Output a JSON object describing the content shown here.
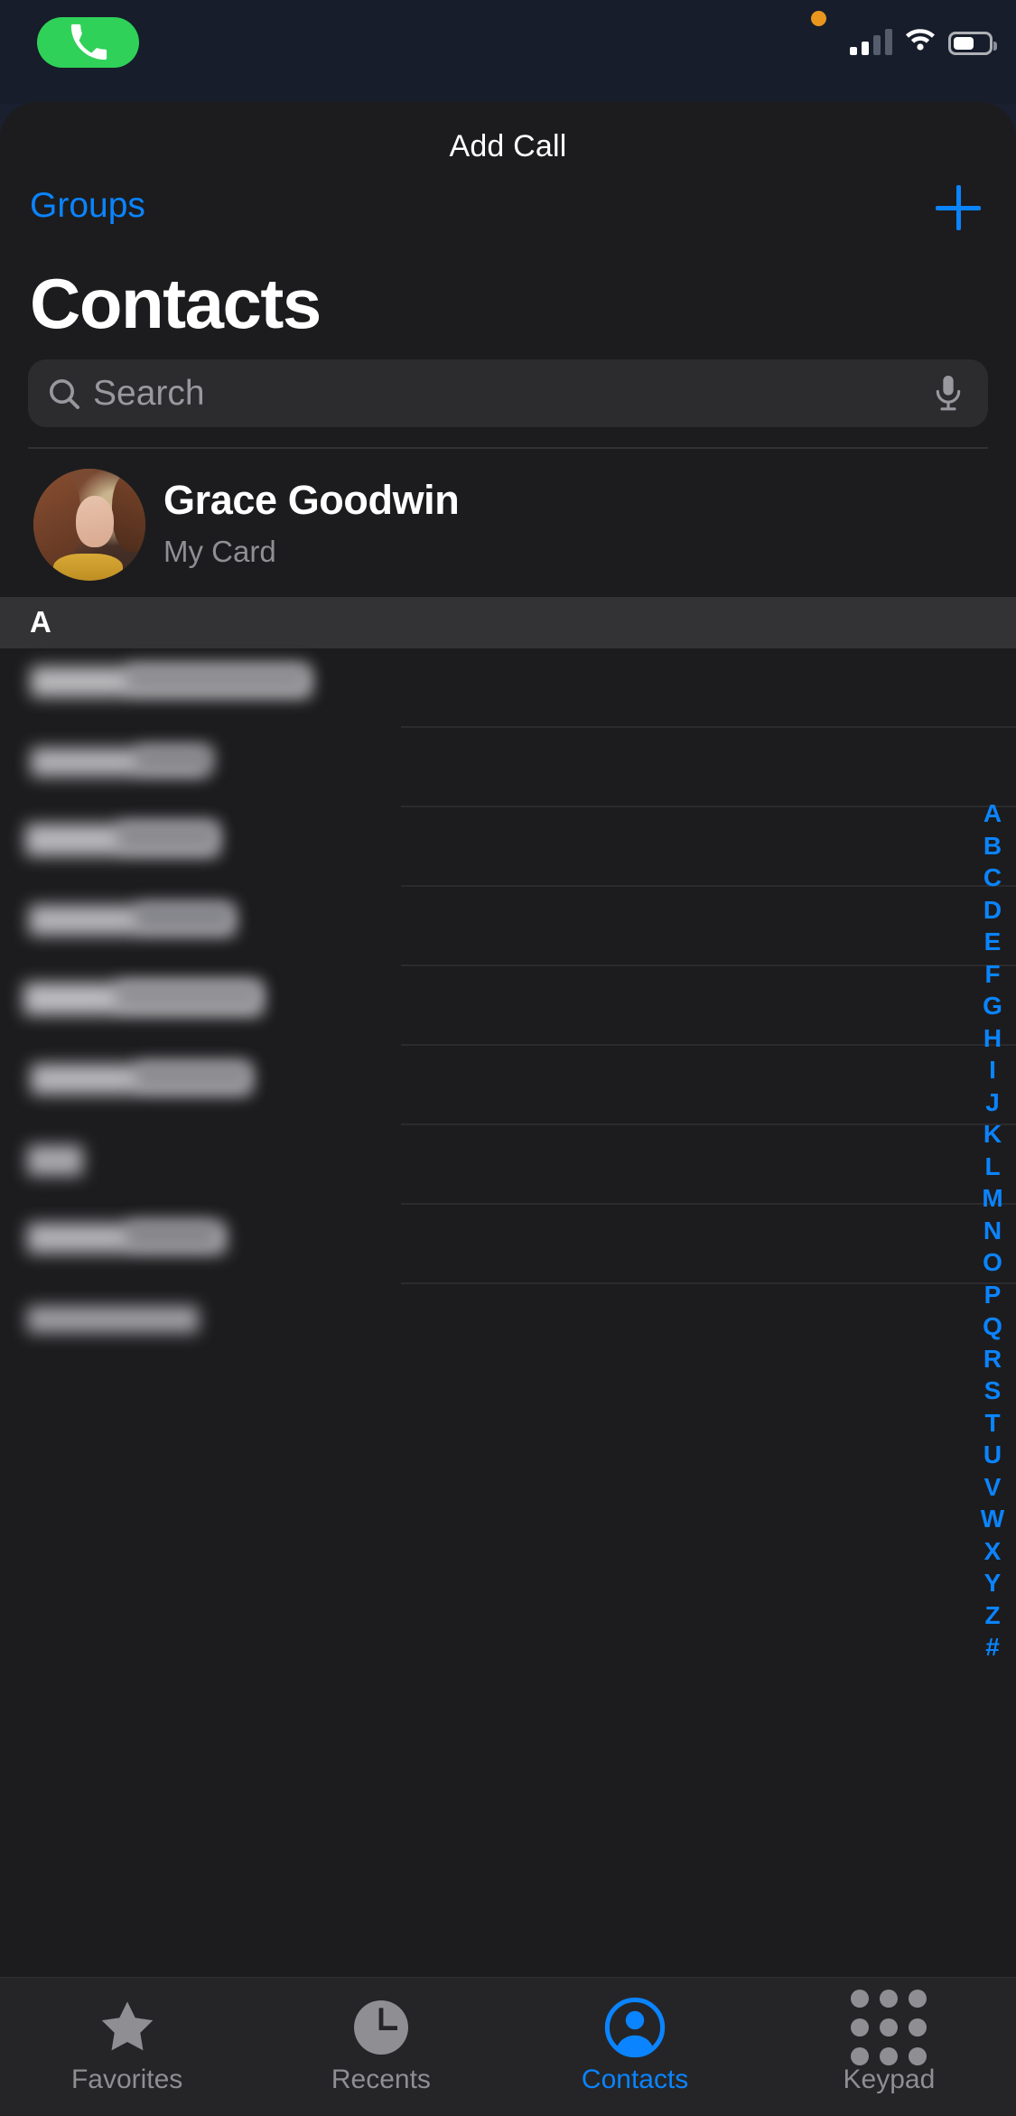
{
  "statusbar": {
    "call_pill_icon": "phone-handset-icon",
    "privacy_indicator": "orange-privacy-dot",
    "cellular_icon": "cellular-signal-icon",
    "cellular_bars_filled": 2,
    "cellular_bars_total": 4,
    "wifi_icon": "wifi-icon",
    "battery_icon": "battery-icon",
    "battery_level_percent": 45
  },
  "nav": {
    "title": "Add Call",
    "groups_label": "Groups",
    "add_icon": "plus-icon"
  },
  "header": {
    "page_title": "Contacts"
  },
  "search": {
    "placeholder": "Search",
    "value": "",
    "search_icon": "search-icon",
    "mic_icon": "microphone-icon"
  },
  "my_card": {
    "name": "Grace Goodwin",
    "subtitle": "My Card",
    "avatar": "contact-photo"
  },
  "sections": [
    {
      "letter": "A",
      "rows": [
        {
          "redacted": true
        },
        {
          "redacted": true
        },
        {
          "redacted": true
        },
        {
          "redacted": true
        },
        {
          "redacted": true
        },
        {
          "redacted": true
        },
        {
          "redacted": true
        },
        {
          "redacted": true
        },
        {
          "redacted": true
        }
      ]
    }
  ],
  "index_letters": [
    "A",
    "B",
    "C",
    "D",
    "E",
    "F",
    "G",
    "H",
    "I",
    "J",
    "K",
    "L",
    "M",
    "N",
    "O",
    "P",
    "Q",
    "R",
    "S",
    "T",
    "U",
    "V",
    "W",
    "X",
    "Y",
    "Z",
    "#"
  ],
  "tabbar": {
    "items": [
      {
        "label": "Favorites",
        "icon": "star-icon",
        "active": false
      },
      {
        "label": "Recents",
        "icon": "clock-icon",
        "active": false
      },
      {
        "label": "Contacts",
        "icon": "person-icon",
        "active": true
      },
      {
        "label": "Keypad",
        "icon": "keypad-icon",
        "active": false
      }
    ]
  },
  "colors": {
    "accent": "#0a84ff",
    "call_green": "#30d158",
    "sheet_bg": "#1c1c1e",
    "status_bg": "#171d2b",
    "section_header_bg": "#333335",
    "secondary_text": "#8e8e93",
    "privacy_orange": "#e8961e"
  }
}
